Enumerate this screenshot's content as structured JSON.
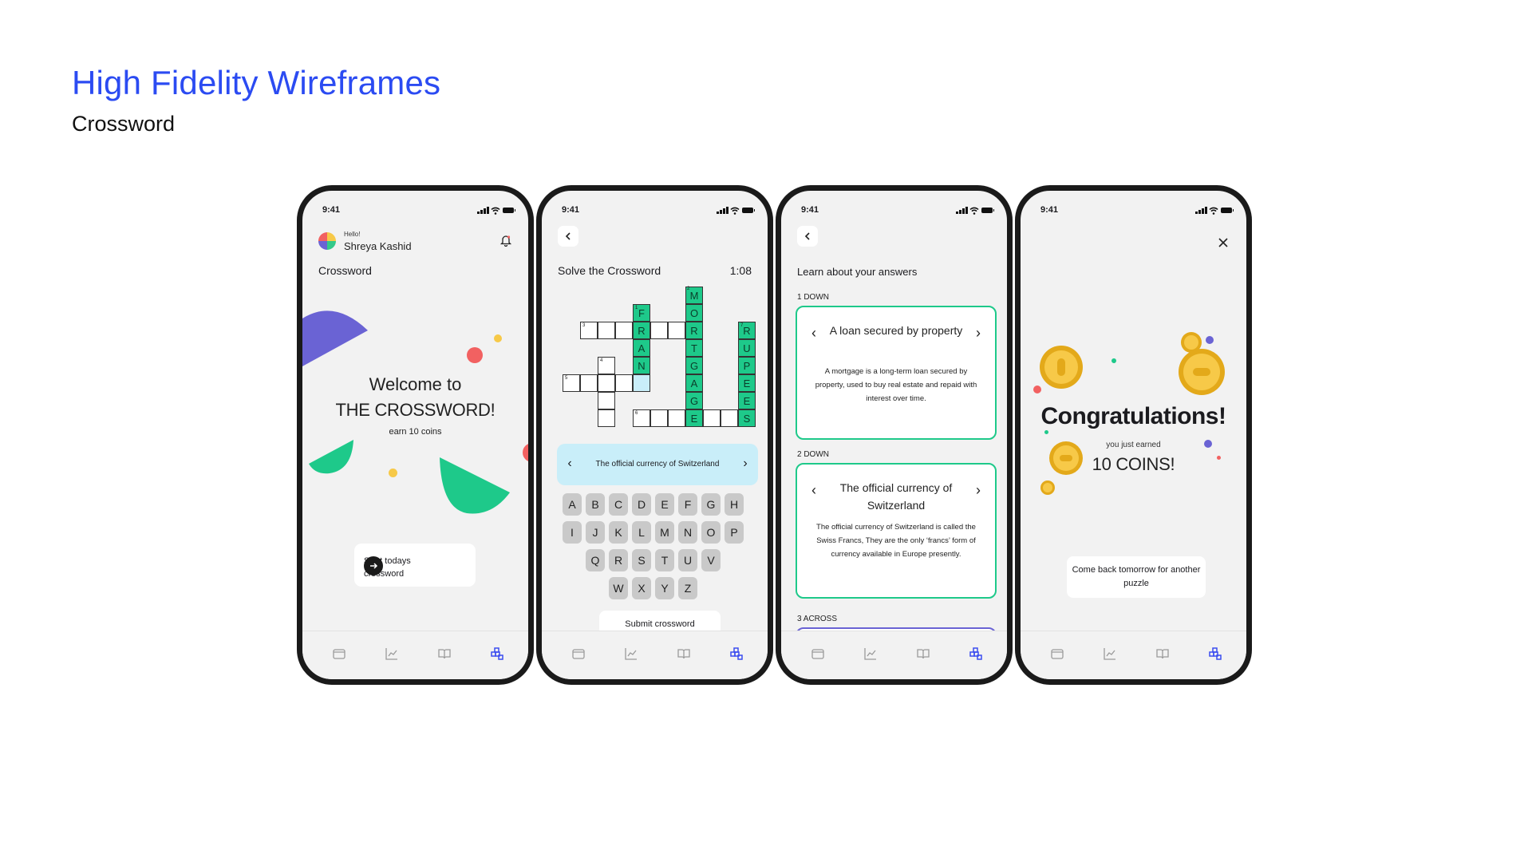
{
  "header": {
    "title": "High Fidelity Wireframes",
    "subtitle": "Crossword"
  },
  "status": {
    "time": "9:41"
  },
  "screen1": {
    "greeting": "Hello!",
    "user_name": "Shreya Kashid",
    "title": "Crossword",
    "welcome_line1": "Welcome to",
    "welcome_line2": "THE CROSSWORD!",
    "earn": "earn 10 coins",
    "cta": "Start todays crossword"
  },
  "screen2": {
    "title": "Solve the Crossword",
    "timer": "1:08",
    "clue": "The official currency of Switzerland",
    "cells_numbers": [
      "1",
      "2",
      "3",
      "4",
      "5",
      "6",
      "7"
    ],
    "word_fran": [
      "F",
      "R",
      "A",
      "N"
    ],
    "word_mortgage": [
      "M",
      "O",
      "R",
      "T",
      "G",
      "A",
      "G",
      "E"
    ],
    "word_rupees": [
      "R",
      "U",
      "P",
      "E",
      "E",
      "S"
    ],
    "keyboard_rows": [
      [
        "A",
        "B",
        "C",
        "D",
        "E",
        "F",
        "G",
        "H"
      ],
      [
        "I",
        "J",
        "K",
        "L",
        "M",
        "N",
        "O",
        "P"
      ],
      [
        "Q",
        "R",
        "S",
        "T",
        "U",
        "V"
      ],
      [
        "W",
        "X",
        "Y",
        "Z"
      ]
    ],
    "submit": "Submit crossword"
  },
  "screen3": {
    "title": "Learn about your answers",
    "sections": [
      {
        "label": "1 DOWN",
        "heading": "A loan secured by property",
        "body": "A mortgage is a long-term loan secured by property, used to buy real estate and repaid with interest over time."
      },
      {
        "label": "2 DOWN",
        "heading": "The official currency of Switzerland",
        "body": "The official currency of Switzerland is called the Swiss Francs, They are the only ‘francs’ form of currency available in Europe presently."
      },
      {
        "label": "3 ACROSS"
      }
    ]
  },
  "screen4": {
    "congrats": "Congratulations!",
    "earned": "you just earned",
    "coins": "10 COINS!",
    "comeback": "Come back tomorrow for another puzzle"
  },
  "tabbar": {
    "icons": [
      "wallet-icon",
      "chart-icon",
      "book-icon",
      "puzzle-icon"
    ],
    "active_color": "#3b4cf0",
    "inactive_color": "#9a9a9a"
  },
  "colors": {
    "accent": "#2b4bf2",
    "green": "#1ec98a",
    "purple": "#6a63d4",
    "coral": "#f26161",
    "yellow": "#f7c948",
    "clue_bg": "#c9eef9"
  }
}
